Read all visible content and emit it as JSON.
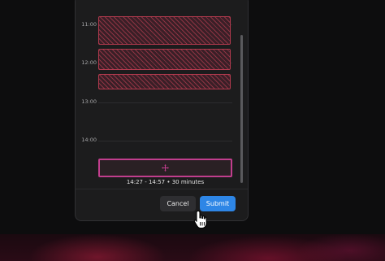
{
  "calendar": {
    "hours": [
      "11:00",
      "12:00",
      "13:00",
      "14:00"
    ],
    "selection_caption": "14:27 - 14:57  •  30 minutes"
  },
  "footer": {
    "cancel_label": "Cancel",
    "submit_label": "Submit"
  },
  "colors": {
    "busy_border": "#b33a4e",
    "selection_border": "#c13e8d",
    "submit_button": "#2e86e6"
  },
  "icons": {
    "selection": "move-icon",
    "pointer": "hand-pointer-cursor-icon"
  }
}
